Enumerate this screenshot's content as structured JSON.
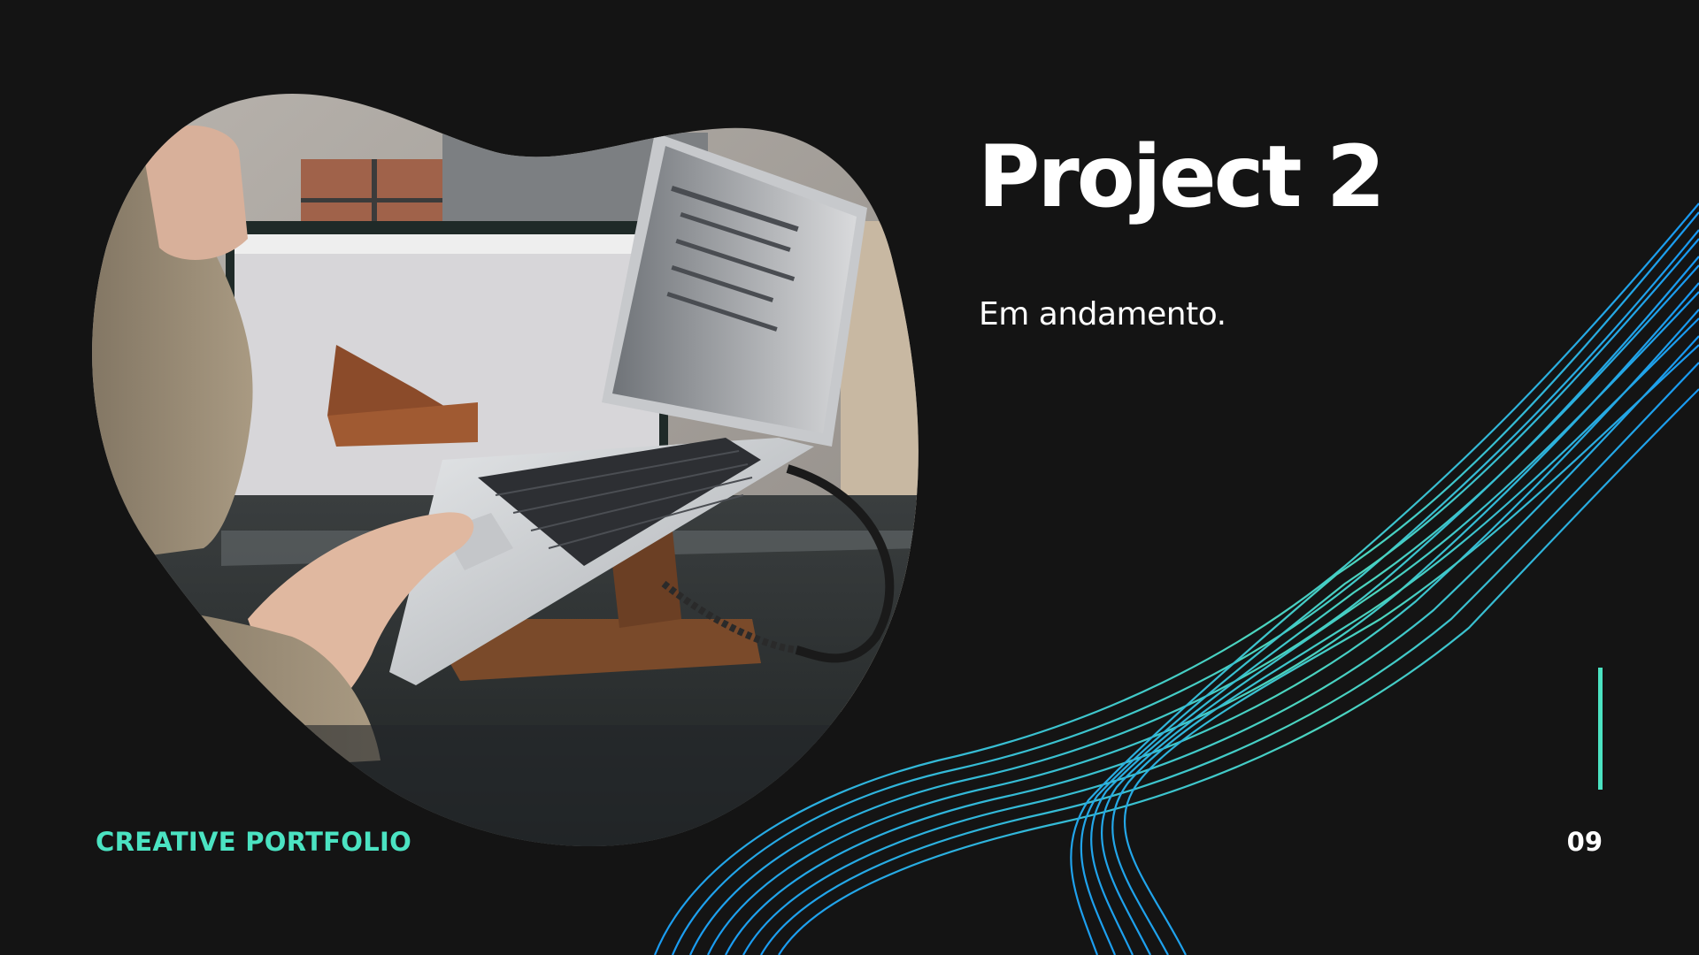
{
  "slide": {
    "title": "Project 2",
    "subtitle": "Em andamento.",
    "footer_brand": "CREATIVE PORTFOLIO",
    "page_number": "09"
  },
  "colors": {
    "background": "#141414",
    "accent": "#4be3c2",
    "wave_gradient_start": "#1aa3ff",
    "wave_gradient_end": "#5ff0c8",
    "text": "#ffffff"
  },
  "image": {
    "subject": "person typing on a laptop on a wooden laptop stand with a monitor behind"
  }
}
